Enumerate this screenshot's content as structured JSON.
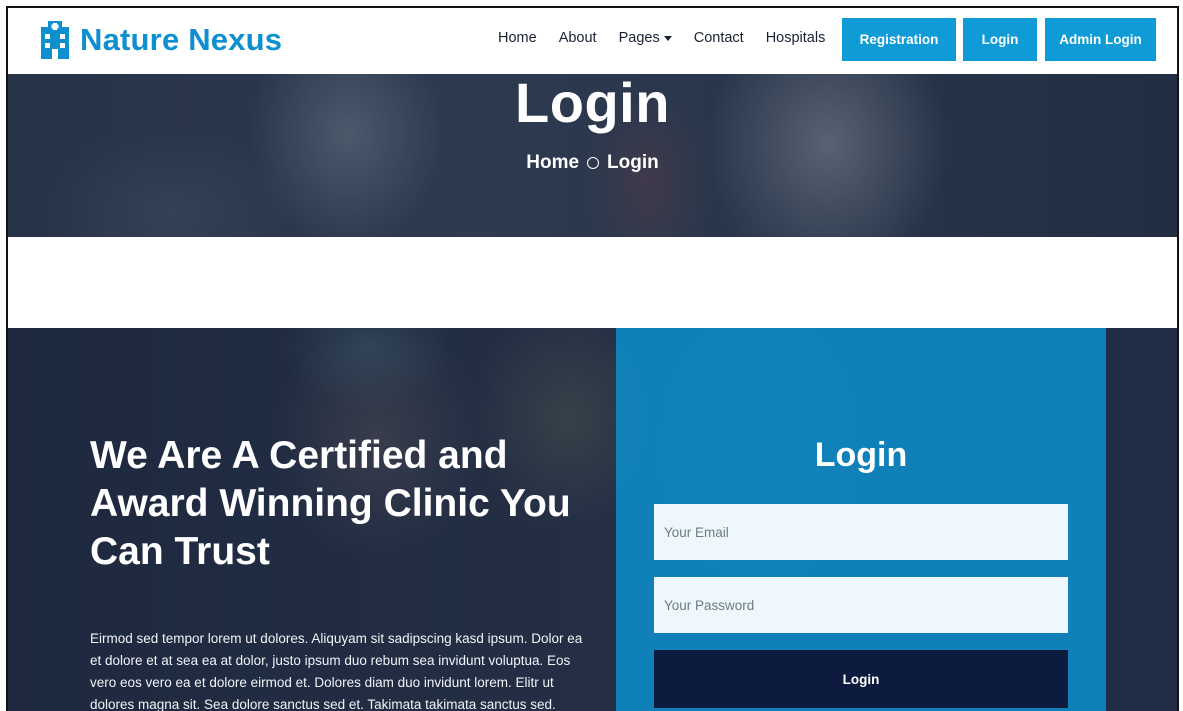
{
  "brand": {
    "name": "Nature Nexus",
    "icon": "hospital-building-icon",
    "color": "#0e8fcf"
  },
  "nav": {
    "links": [
      {
        "label": "Home"
      },
      {
        "label": "About"
      },
      {
        "label": "Pages"
      },
      {
        "label": "Contact"
      },
      {
        "label": "Hospitals"
      }
    ],
    "buttons": [
      {
        "label": "Registration"
      },
      {
        "label": "Login"
      },
      {
        "label": "Admin Login"
      }
    ],
    "button_color": "#0e9bd6"
  },
  "page_header": {
    "title": "Login",
    "breadcrumb": {
      "home": "Home",
      "current": "Login"
    }
  },
  "hero": {
    "heading": "We Are A Certified and Award Winning Clinic You Can Trust",
    "text": "Eirmod sed tempor lorem ut dolores. Aliquyam sit sadipscing kasd ipsum. Dolor ea et dolore et at sea ea at dolor, justo ipsum duo rebum sea invidunt voluptua. Eos vero eos vero ea et dolore eirmod et. Dolores diam duo invidunt lorem. Elitr ut dolores magna sit. Sea dolore sanctus sed et. Takimata takimata sanctus sed."
  },
  "login_form": {
    "title": "Login",
    "email_placeholder": "Your Email",
    "password_placeholder": "Your Password",
    "submit_label": "Login",
    "panel_color": "#0e8cc8",
    "submit_color": "#0d1c3e"
  }
}
